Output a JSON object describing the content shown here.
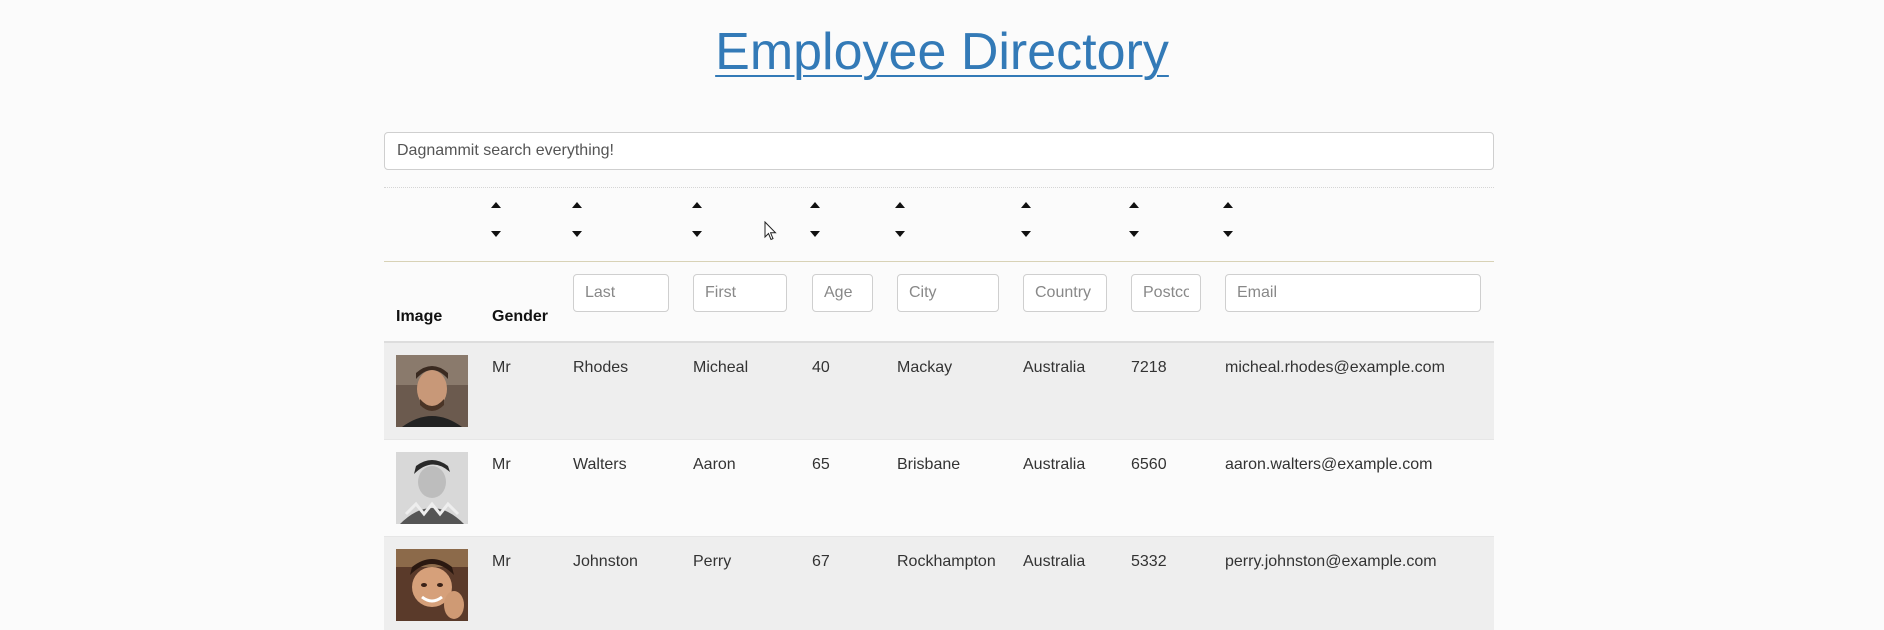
{
  "page": {
    "title": "Employee Directory"
  },
  "search": {
    "placeholder": "Dagnammit search everything!"
  },
  "columns": {
    "image": "Image",
    "gender": "Gender",
    "last_placeholder": "Last",
    "first_placeholder": "First",
    "age_placeholder": "Age",
    "city_placeholder": "City",
    "country_placeholder": "Country",
    "postcode_placeholder": "Postcode",
    "email_placeholder": "Email"
  },
  "rows": [
    {
      "gender": "Mr",
      "last": "Rhodes",
      "first": "Micheal",
      "age": "40",
      "city": "Mackay",
      "country": "Australia",
      "postcode": "7218",
      "email": "micheal.rhodes@example.com"
    },
    {
      "gender": "Mr",
      "last": "Walters",
      "first": "Aaron",
      "age": "65",
      "city": "Brisbane",
      "country": "Australia",
      "postcode": "6560",
      "email": "aaron.walters@example.com"
    },
    {
      "gender": "Mr",
      "last": "Johnston",
      "first": "Perry",
      "age": "67",
      "city": "Rockhampton",
      "country": "Australia",
      "postcode": "5332",
      "email": "perry.johnston@example.com"
    }
  ],
  "colors": {
    "title": "#337ab7",
    "stripe": "#eeeeee"
  }
}
